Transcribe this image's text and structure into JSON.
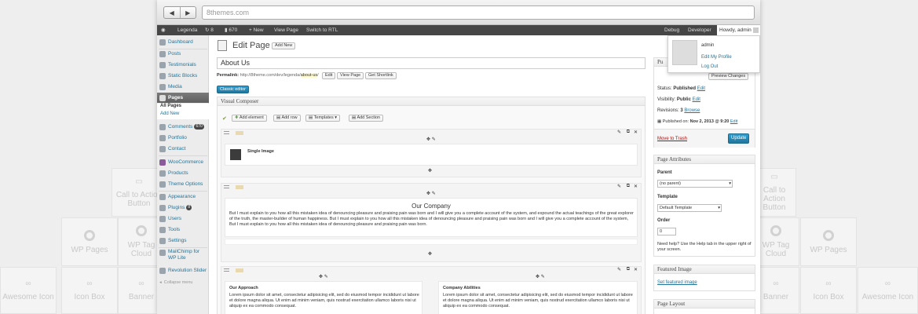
{
  "background": {
    "tiles": [
      {
        "label": "Call to Action Button",
        "icon": "chat-icon"
      },
      {
        "label": "WP Pages",
        "icon": "wordpress-icon"
      },
      {
        "label": "WP Tag Cloud",
        "icon": "wordpress-icon"
      },
      {
        "label": "Awesome Icon",
        "icon": "link-icon"
      },
      {
        "label": "Icon Box",
        "icon": "link-icon"
      },
      {
        "label": "Banner",
        "icon": "link-icon"
      }
    ]
  },
  "browser": {
    "url": "8themes.com",
    "back": "◀",
    "forward": "▶"
  },
  "adminbar": {
    "site": "Legenda",
    "updates": "8",
    "comments": "670",
    "new": "New",
    "view_page": "View Page",
    "rtl": "Switch to RTL",
    "debug": "Debug",
    "developer": "Developer",
    "howdy": "Howdy, admin"
  },
  "user_menu": {
    "name": "admin",
    "edit_profile": "Edit My Profile",
    "logout": "Log Out"
  },
  "sidebar": {
    "items": [
      {
        "label": "Dashboard"
      },
      {
        "label": "Posts"
      },
      {
        "label": "Testimonials"
      },
      {
        "label": "Static Blocks"
      },
      {
        "label": "Media"
      },
      {
        "label": "Pages"
      },
      {
        "label": "Comments",
        "badge": "670"
      },
      {
        "label": "Portfolio"
      },
      {
        "label": "Contact"
      },
      {
        "label": "WooCommerce"
      },
      {
        "label": "Products"
      },
      {
        "label": "Theme Options"
      },
      {
        "label": "Appearance"
      },
      {
        "label": "Plugins",
        "badge": "8"
      },
      {
        "label": "Users"
      },
      {
        "label": "Tools"
      },
      {
        "label": "Settings"
      },
      {
        "label": "MailChimp for WP Lite"
      },
      {
        "label": "Revolution Slider"
      }
    ],
    "sub": {
      "all_pages": "All Pages",
      "add_new": "Add New"
    },
    "collapse": "Collapse menu"
  },
  "editor": {
    "heading": "Edit Page",
    "add_new": "Add New",
    "title": "About Us",
    "permalink_label": "Permalink:",
    "permalink_url": "http://8theme.com/dev/legenda/",
    "permalink_slug": "about-us",
    "edit": "Edit",
    "view_page": "View Page",
    "shortlink": "Get Shortlink",
    "classic": "Classic editor"
  },
  "composer": {
    "title": "Visual Composer",
    "add_element": "Add element",
    "add_row": "Add row",
    "templates": "Templates",
    "add_section": "Add Section",
    "single_image": "Single Image",
    "company_title": "Our Company",
    "company_text": "But I must explain to you how all this mistaken idea of denouncing pleasure and praising pain was born and I will give you a complete account of the system, and expound the actual teachings of the great explorer of the truth, the master-builder of human happiness. But I must explain to you how all this mistaken idea of denouncing pleasure and praising pain was born and I will give you a complete account of the system, But I must explain to you how all this mistaken idea of denouncing pleasure and praising pain was born.",
    "approach_title": "Our Approach",
    "approach_text": "Lorem ipsum dolor sit amet, consectetur adipisicing elit, sed do eiusmod tempor incididunt ut labore et dolore magna aliqua. Ut enim ad minim veniam, quis nostrud exercitation ullamco laboris nisi ut aliquip ex ea commodo consequat.",
    "abilities_title": "Company Abilities",
    "abilities_text": "Lorem ipsum dolor sit amet, consectetur adipisicing elit, sed do eiusmod tempor incididunt ut labore et dolore magna aliqua. Ut enim ad minim veniam, quis nostrud exercitation ullamco laboris nisi ut aliquip ex ea commodo consequat."
  },
  "publish": {
    "title": "Pu",
    "preview": "Preview Changes",
    "status_label": "Status:",
    "status": "Published",
    "visibility_label": "Visibility:",
    "visibility": "Public",
    "revisions_label": "Revisions:",
    "revisions": "3",
    "browse": "Browse",
    "published_on": "Published on:",
    "date": "Nov 2, 2013 @ 9:20",
    "edit": "Edit",
    "trash": "Move to Trash",
    "update": "Update"
  },
  "attributes": {
    "title": "Page Attributes",
    "parent_label": "Parent",
    "parent": "(no parent)",
    "template_label": "Template",
    "template": "Default Template",
    "order_label": "Order",
    "order": "0",
    "help": "Need help? Use the Help tab in the upper right of your screen."
  },
  "featured": {
    "title": "Featured Image",
    "link": "Set featured image"
  },
  "layout": {
    "title": "Page Layout"
  }
}
